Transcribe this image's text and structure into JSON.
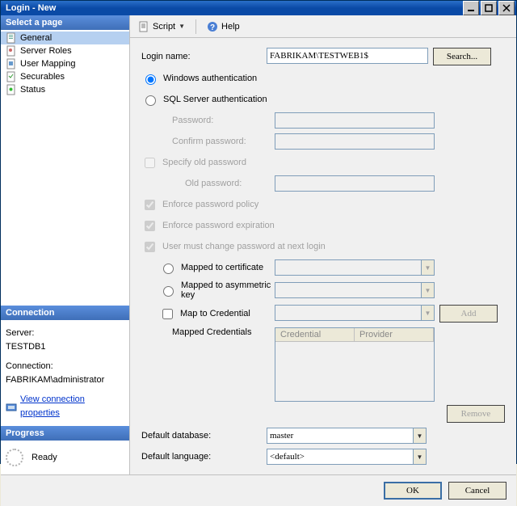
{
  "titlebar": {
    "title": "Login - New"
  },
  "pages_header": "Select a page",
  "pages": [
    {
      "label": "General"
    },
    {
      "label": "Server Roles"
    },
    {
      "label": "User Mapping"
    },
    {
      "label": "Securables"
    },
    {
      "label": "Status"
    }
  ],
  "toolbar": {
    "script_label": "Script",
    "help_label": "Help"
  },
  "form": {
    "login_name_label": "Login name:",
    "login_name_value": "FABRIKAM\\TESTWEB1$",
    "search_label": "Search...",
    "windows_auth_label": "Windows authentication",
    "sql_auth_label": "SQL Server authentication",
    "password_label": "Password:",
    "confirm_password_label": "Confirm password:",
    "specify_old_label": "Specify old password",
    "old_password_label": "Old password:",
    "enforce_policy_label": "Enforce password policy",
    "enforce_expiration_label": "Enforce password expiration",
    "must_change_label": "User must change password at next login",
    "mapped_cert_label": "Mapped to certificate",
    "mapped_asym_label": "Mapped to asymmetric key",
    "map_cred_label": "Map to Credential",
    "mapped_creds_label": "Mapped Credentials",
    "cred_col_credential": "Credential",
    "cred_col_provider": "Provider",
    "add_label": "Add",
    "remove_label": "Remove",
    "default_db_label": "Default database:",
    "default_db_value": "master",
    "default_lang_label": "Default language:",
    "default_lang_value": "<default>"
  },
  "connection": {
    "header": "Connection",
    "server_label": "Server:",
    "server_value": "TESTDB1",
    "conn_label": "Connection:",
    "conn_value": "FABRIKAM\\administrator",
    "view_props_label": "View connection properties"
  },
  "progress": {
    "header": "Progress",
    "status": "Ready"
  },
  "footer": {
    "ok_label": "OK",
    "cancel_label": "Cancel"
  }
}
